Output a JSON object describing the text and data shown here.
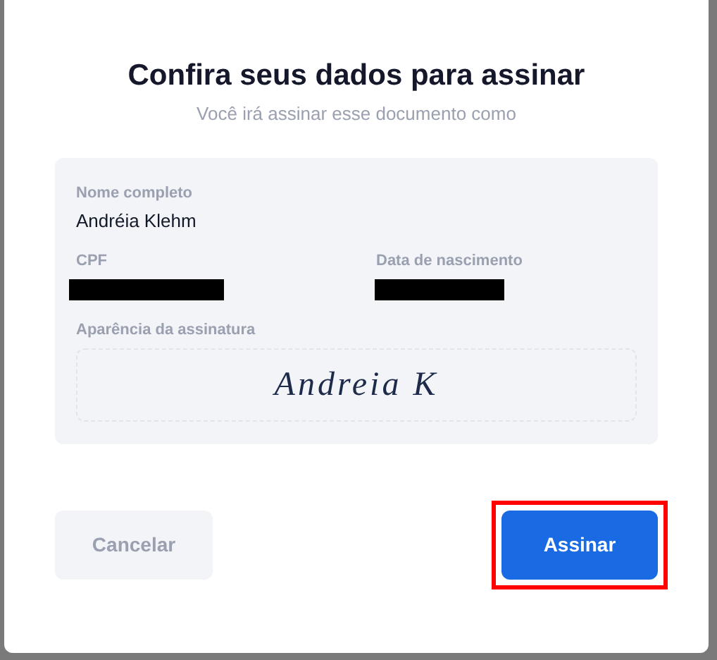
{
  "dialog": {
    "title": "Confira seus dados para assinar",
    "subtitle": "Você irá assinar esse documento como"
  },
  "fields": [
    {
      "label": "Nome completo",
      "kind": "text",
      "value": "Andréia Klehm"
    },
    {
      "label": "CPF",
      "kind": "redacted"
    },
    {
      "label": "Data de nascimento",
      "kind": "redacted"
    }
  ],
  "signature": {
    "label": "Aparência da assinatura",
    "value": "Andreia K"
  },
  "buttons": [
    {
      "label": "Cancelar",
      "kind": "secondary",
      "highlighted": false
    },
    {
      "label": "Assinar",
      "kind": "primary",
      "highlighted": true
    }
  ]
}
